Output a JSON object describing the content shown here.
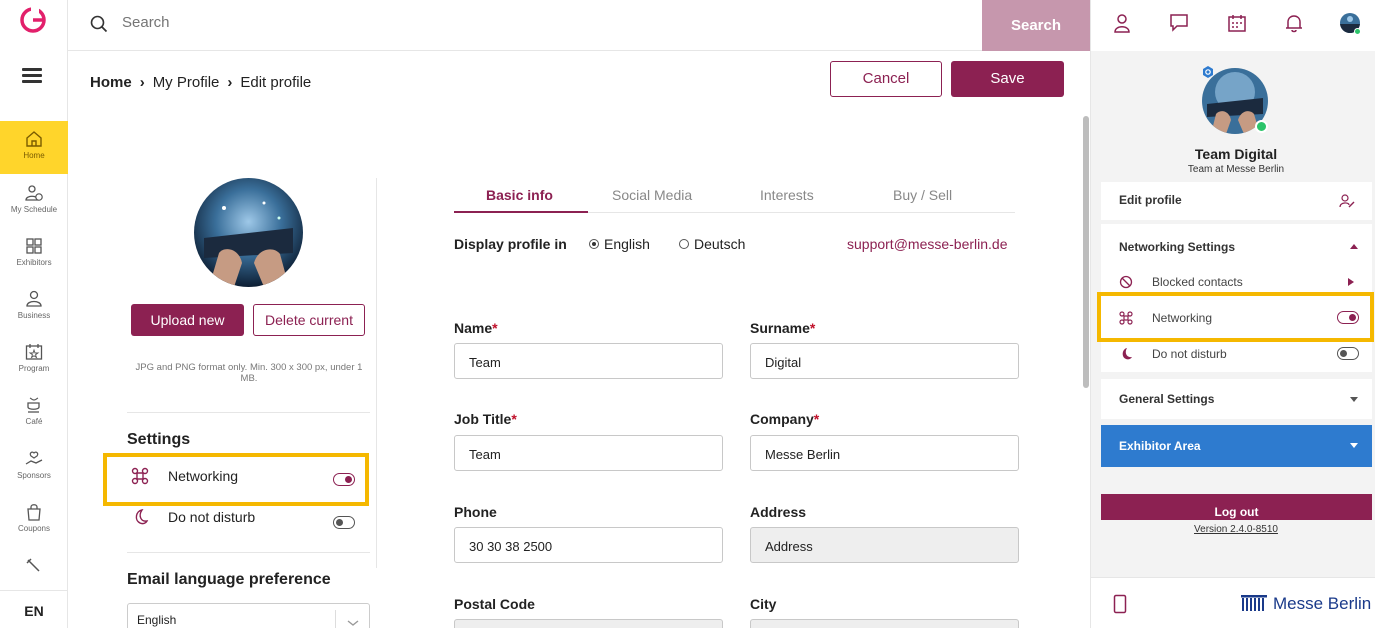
{
  "nav": {
    "items": [
      {
        "label": "Home",
        "icon": "home-icon"
      },
      {
        "label": "My Schedule",
        "icon": "schedule-icon"
      },
      {
        "label": "Exhibitors",
        "icon": "exhibitors-icon"
      },
      {
        "label": "Business",
        "icon": "business-icon"
      },
      {
        "label": "Program",
        "icon": "program-icon"
      },
      {
        "label": "Café",
        "icon": "cafe-icon"
      },
      {
        "label": "Sponsors",
        "icon": "sponsors-icon"
      },
      {
        "label": "Coupons",
        "icon": "coupons-icon"
      }
    ],
    "language": "EN"
  },
  "search": {
    "placeholder": "Search",
    "button_label": "Search"
  },
  "breadcrumb": {
    "home": "Home",
    "sep": "›",
    "profile": "My Profile",
    "current": "Edit profile"
  },
  "actions": {
    "cancel": "Cancel",
    "save": "Save"
  },
  "photo": {
    "upload": "Upload new",
    "delete": "Delete current",
    "hint": "JPG and PNG format only. Min. 300 x 300 px, under 1 MB."
  },
  "settings": {
    "title": "Settings",
    "networking": "Networking",
    "dnd": "Do not disturb"
  },
  "email_pref": {
    "title": "Email language preference",
    "value": "English"
  },
  "tabs": [
    "Basic info",
    "Social Media",
    "Interests",
    "Buy / Sell"
  ],
  "display": {
    "label": "Display profile in",
    "options": [
      "English",
      "Deutsch"
    ],
    "support": "support@messe-berlin.de"
  },
  "form": {
    "name_label": "Name",
    "name_value": "Team",
    "surname_label": "Surname",
    "surname_value": "Digital",
    "job_label": "Job Title",
    "job_value": "Team",
    "company_label": "Company",
    "company_value": "Messe Berlin",
    "phone_label": "Phone",
    "phone_value": "30 30 38 2500",
    "address_label": "Address",
    "address_placeholder": "Address",
    "postal_label": "Postal Code",
    "city_label": "City",
    "required_mark": "*"
  },
  "panel": {
    "name": "Team Digital",
    "subtitle": "Team at Messe Berlin",
    "edit_profile": "Edit profile",
    "networking_settings": "Networking Settings",
    "blocked": "Blocked contacts",
    "networking": "Networking",
    "dnd": "Do not disturb",
    "general": "General Settings",
    "exhibitor": "Exhibitor Area",
    "logout": "Log out",
    "version": "Version 2.4.0-8510",
    "brand": "Messe Berlin"
  },
  "colors": {
    "accent": "#8c2152",
    "highlight": "#f5b800",
    "active_nav": "#ffd52b",
    "exhibitor_blue": "#2e7bcf"
  }
}
